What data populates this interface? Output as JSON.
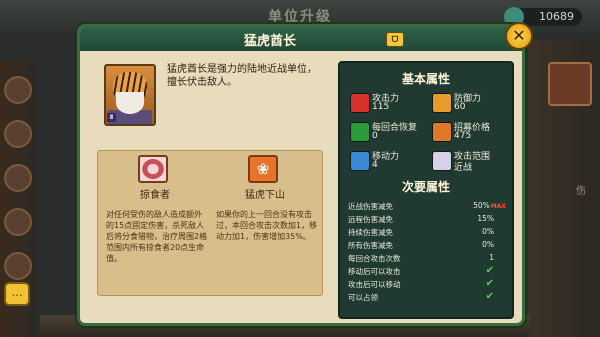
{
  "background": {
    "title": "单位升级",
    "currency": "10689",
    "side_text": "伤"
  },
  "panel": {
    "title": "猛虎酋长",
    "title_badge_icon": "mask-icon",
    "description": "猛虎酋长是强力的陆地近战单位，擅长伏击敌人。"
  },
  "abilities": [
    {
      "icon": "meat-icon",
      "name": "掠食者",
      "description": "对任何受伤的敌人造成额外的15点固定伤害，杀死敌人后将分食猎物，治疗周围2格范围内所有掠食者20点生命值。"
    },
    {
      "icon": "paw-icon",
      "name": "猛虎下山",
      "description": "如果你的上一回合没有攻击过，本回合攻击次数加1，移动力加1，伤害增加35%。"
    }
  ],
  "stats": {
    "basic_title": "基本属性",
    "basic": [
      {
        "label": "攻击力",
        "value": "115",
        "icon": "sword-icon",
        "color": "#d8322a"
      },
      {
        "label": "防御力",
        "value": "60",
        "icon": "shield-icon",
        "color": "#e79b2b"
      },
      {
        "label": "每回合恢复",
        "value": "0",
        "icon": "heal-icon",
        "color": "#2a9a3a"
      },
      {
        "label": "招募价格",
        "value": "475",
        "icon": "coin-icon",
        "color": "#e0782a"
      },
      {
        "label": "移动力",
        "value": "4",
        "icon": "boot-icon",
        "color": "#3a8ad8"
      },
      {
        "label": "攻击范围",
        "value": "近战",
        "icon": "range-icon",
        "color": "#d8d0e8"
      }
    ],
    "secondary_title": "次要属性",
    "secondary": [
      {
        "label": "近战伤害减免",
        "value": "50%",
        "max": "MAX"
      },
      {
        "label": "远程伤害减免",
        "value": "15%"
      },
      {
        "label": "持续伤害减免",
        "value": "0%"
      },
      {
        "label": "所有伤害减免",
        "value": "0%"
      },
      {
        "label": "每回合攻击次数",
        "value": "1"
      },
      {
        "label": "移动后可以攻击",
        "check": true
      },
      {
        "label": "攻击后可以移动",
        "check": true
      },
      {
        "label": "可以占领",
        "check": true
      }
    ]
  }
}
